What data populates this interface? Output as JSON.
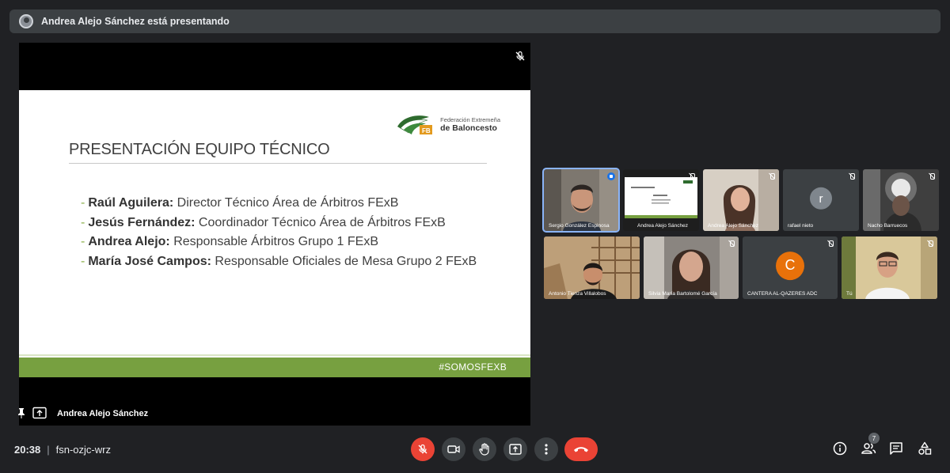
{
  "banner": {
    "text": "Andrea Alejo Sánchez está presentando"
  },
  "slide": {
    "logo_line1": "Federación Extremeña",
    "logo_line2": "de Baloncesto",
    "title": "PRESENTACIÓN EQUIPO TÉCNICO",
    "items": [
      {
        "name": "Raúl Aguilera:",
        "role": " Director Técnico Área de Árbitros FExB"
      },
      {
        "name": "Jesús Fernández:",
        "role": " Coordinador Técnico Área de Árbitros FExB"
      },
      {
        "name": "Andrea Alejo:",
        "role": " Responsable Árbitros Grupo 1 FExB"
      },
      {
        "name": "María José Campos:",
        "role": " Responsable Oficiales de Mesa Grupo 2 FExB"
      }
    ],
    "footer": "#SOMOSFEXB"
  },
  "stage": {
    "presenter_name": "Andrea Alejo Sánchez"
  },
  "tiles": {
    "t1": "Sergio González Espinosa",
    "t2": "Andrea Alejo Sánchez",
    "t3": "Andrea Alejo Sánchez",
    "t4": "rafael nieto",
    "t4_letter": "r",
    "t5": "Nacho Barruecos",
    "t6": "Antonio Tienza Villalobos",
    "t7": "Silvia María Bartolomé García",
    "t8": "CANTERA AL-QAZERES ADC",
    "t8_letter": "C",
    "t9": "Tú"
  },
  "bottom": {
    "time": "20:38",
    "separator": "|",
    "code": "fsn-ozjc-wrz",
    "people_count": "7"
  },
  "colors": {
    "accent": "#8ab4f8",
    "danger": "#ea4335",
    "slide_green": "#77a040",
    "avatar_orange": "#e8710a",
    "avatar_gray": "#7f868d"
  }
}
